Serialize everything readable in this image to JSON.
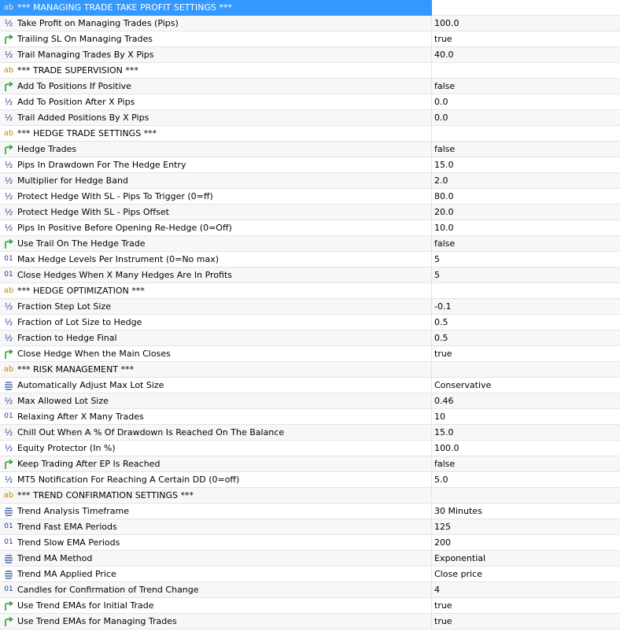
{
  "rows": [
    {
      "icon": "ab-icon",
      "name": "*** MANAGING TRADE TAKE PROFIT SETTINGS ***",
      "value": ""
    },
    {
      "icon": "half-icon",
      "name": "Take Profit on Managing Trades (Pips)",
      "value": "100.0"
    },
    {
      "icon": "arrow-icon",
      "name": "Trailing SL On Managing Trades",
      "value": "true"
    },
    {
      "icon": "half-icon",
      "name": "Trail Managing Trades By X Pips",
      "value": "40.0"
    },
    {
      "icon": "ab-icon",
      "name": "*** TRADE SUPERVISION ***",
      "value": ""
    },
    {
      "icon": "arrow-icon",
      "name": "Add To Positions If Positive",
      "value": "false"
    },
    {
      "icon": "half-icon",
      "name": "Add To Position After X Pips",
      "value": "0.0"
    },
    {
      "icon": "half-icon",
      "name": "Trail Added Positions By X Pips",
      "value": "0.0"
    },
    {
      "icon": "ab-icon",
      "name": "*** HEDGE TRADE SETTINGS ***",
      "value": ""
    },
    {
      "icon": "arrow-icon",
      "name": "Hedge Trades",
      "value": "false"
    },
    {
      "icon": "half-icon",
      "name": "Pips In Drawdown For The Hedge Entry",
      "value": "15.0"
    },
    {
      "icon": "half-icon",
      "name": "Multiplier for Hedge Band",
      "value": "2.0"
    },
    {
      "icon": "half-icon",
      "name": "Protect Hedge With SL - Pips To Trigger (0=ff)",
      "value": "80.0"
    },
    {
      "icon": "half-icon",
      "name": "Protect Hedge With SL - Pips Offset",
      "value": "20.0"
    },
    {
      "icon": "half-icon",
      "name": "Pips In Positive Before Opening Re-Hedge (0=Off)",
      "value": "10.0"
    },
    {
      "icon": "arrow-icon",
      "name": "Use Trail On The Hedge Trade",
      "value": "false"
    },
    {
      "icon": "01-icon",
      "name": "Max Hedge Levels Per Instrument (0=No max)",
      "value": "5"
    },
    {
      "icon": "01-icon",
      "name": "Close Hedges When X Many Hedges Are In Profits",
      "value": "5"
    },
    {
      "icon": "ab-icon",
      "name": "*** HEDGE OPTIMIZATION ***",
      "value": ""
    },
    {
      "icon": "half-icon",
      "name": "Fraction Step Lot Size",
      "value": "-0.1"
    },
    {
      "icon": "half-icon",
      "name": "Fraction of Lot Size to Hedge",
      "value": "0.5"
    },
    {
      "icon": "half-icon",
      "name": "Fraction to Hedge Final",
      "value": "0.5"
    },
    {
      "icon": "arrow-icon",
      "name": "Close Hedge When the Main Closes",
      "value": "true"
    },
    {
      "icon": "ab-icon",
      "name": "*** RISK MANAGEMENT ***",
      "value": ""
    },
    {
      "icon": "list-icon",
      "name": "Automatically Adjust Max Lot Size",
      "value": "Conservative"
    },
    {
      "icon": "half-icon",
      "name": "Max Allowed Lot Size",
      "value": "0.46"
    },
    {
      "icon": "01-icon",
      "name": "Relaxing After X Many Trades",
      "value": "10"
    },
    {
      "icon": "half-icon",
      "name": "Chill Out When A % Of Drawdown Is Reached On The Balance",
      "value": "15.0"
    },
    {
      "icon": "half-icon",
      "name": "Equity Protector (In %)",
      "value": "100.0"
    },
    {
      "icon": "arrow-icon",
      "name": "Keep Trading After EP Is Reached",
      "value": "false"
    },
    {
      "icon": "half-icon",
      "name": "MT5 Notification For Reaching A Certain DD (0=off)",
      "value": "5.0"
    },
    {
      "icon": "ab-icon",
      "name": "*** TREND CONFIRMATION SETTINGS ***",
      "value": ""
    },
    {
      "icon": "list-icon",
      "name": "Trend Analysis Timeframe",
      "value": "30 Minutes"
    },
    {
      "icon": "01-icon",
      "name": "Trend Fast EMA Periods",
      "value": "125"
    },
    {
      "icon": "01-icon",
      "name": "Trend Slow EMA Periods",
      "value": "200"
    },
    {
      "icon": "list-icon",
      "name": "Trend MA Method",
      "value": "Exponential"
    },
    {
      "icon": "list-icon",
      "name": "Trend MA Applied Price",
      "value": "Close price"
    },
    {
      "icon": "01-icon",
      "name": "Candles for Confirmation of Trend Change",
      "value": "4"
    },
    {
      "icon": "arrow-icon",
      "name": "Use Trend EMAs for Initial Trade",
      "value": "true"
    },
    {
      "icon": "arrow-icon",
      "name": "Use Trend EMAs for Managing Trades",
      "value": "true"
    }
  ],
  "icon_glyphs": {
    "ab-icon": "ab",
    "half-icon": "½",
    "01-icon": "01"
  },
  "selected_row": 0,
  "colors": {
    "selection": "#3399ff",
    "arrow_green": "#2e9e3b",
    "list_blue": "#3a5ea8"
  }
}
